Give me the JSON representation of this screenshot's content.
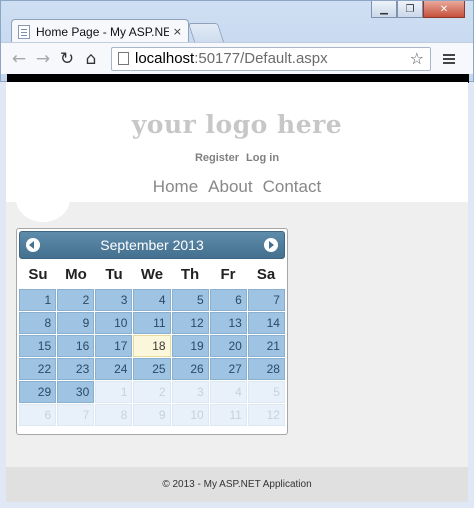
{
  "browser": {
    "tab_title": "Home Page - My ASP.NET",
    "tab_close": "×",
    "url_host": "localhost",
    "url_rest": ":50177/Default.aspx",
    "icons": {
      "back": "back-arrow-icon",
      "forward": "forward-arrow-icon",
      "reload": "reload-icon",
      "home": "home-icon",
      "star": "star-icon",
      "menu": "hamburger-menu-icon"
    }
  },
  "site": {
    "logo": "your logo here",
    "register": "Register",
    "login": "Log in",
    "nav": [
      "Home",
      "About",
      "Contact"
    ],
    "footer": "© 2013 - My ASP.NET Application"
  },
  "calendar": {
    "title": "September 2013",
    "weekdays": [
      "Su",
      "Mo",
      "Tu",
      "We",
      "Th",
      "Fr",
      "Sa"
    ],
    "days": [
      {
        "d": "1",
        "t": "cur"
      },
      {
        "d": "2",
        "t": "cur"
      },
      {
        "d": "3",
        "t": "cur"
      },
      {
        "d": "4",
        "t": "cur"
      },
      {
        "d": "5",
        "t": "cur"
      },
      {
        "d": "6",
        "t": "cur"
      },
      {
        "d": "7",
        "t": "cur"
      },
      {
        "d": "8",
        "t": "cur"
      },
      {
        "d": "9",
        "t": "cur"
      },
      {
        "d": "10",
        "t": "cur"
      },
      {
        "d": "11",
        "t": "cur"
      },
      {
        "d": "12",
        "t": "cur"
      },
      {
        "d": "13",
        "t": "cur"
      },
      {
        "d": "14",
        "t": "cur"
      },
      {
        "d": "15",
        "t": "cur"
      },
      {
        "d": "16",
        "t": "cur"
      },
      {
        "d": "17",
        "t": "cur"
      },
      {
        "d": "18",
        "t": "today"
      },
      {
        "d": "19",
        "t": "cur"
      },
      {
        "d": "20",
        "t": "cur"
      },
      {
        "d": "21",
        "t": "cur"
      },
      {
        "d": "22",
        "t": "cur"
      },
      {
        "d": "23",
        "t": "cur"
      },
      {
        "d": "24",
        "t": "cur"
      },
      {
        "d": "25",
        "t": "cur"
      },
      {
        "d": "26",
        "t": "cur"
      },
      {
        "d": "27",
        "t": "cur"
      },
      {
        "d": "28",
        "t": "cur"
      },
      {
        "d": "29",
        "t": "cur"
      },
      {
        "d": "30",
        "t": "cur"
      },
      {
        "d": "1",
        "t": "other"
      },
      {
        "d": "2",
        "t": "other"
      },
      {
        "d": "3",
        "t": "other"
      },
      {
        "d": "4",
        "t": "other"
      },
      {
        "d": "5",
        "t": "other"
      },
      {
        "d": "6",
        "t": "other"
      },
      {
        "d": "7",
        "t": "other"
      },
      {
        "d": "8",
        "t": "other"
      },
      {
        "d": "9",
        "t": "other"
      },
      {
        "d": "10",
        "t": "other"
      },
      {
        "d": "11",
        "t": "other"
      },
      {
        "d": "12",
        "t": "other"
      }
    ],
    "colors": {
      "header": "#45708f",
      "day": "#9ec3e3",
      "today": "#fbf7da",
      "other": "#e8f1f9"
    }
  }
}
